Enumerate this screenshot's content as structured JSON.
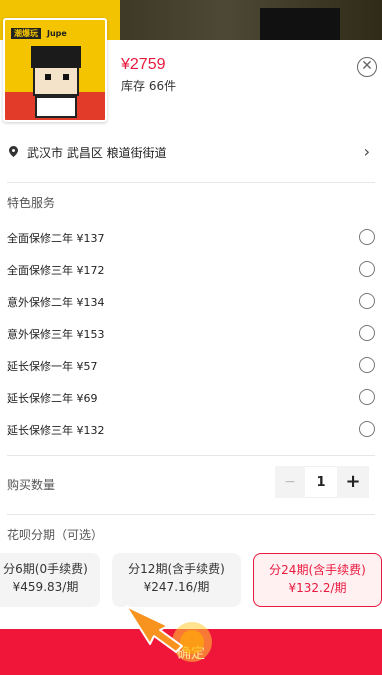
{
  "product": {
    "price": "¥2759",
    "stock": "库存 66件",
    "thumb_brands": [
      "潮爆玩",
      "Jupe"
    ]
  },
  "address": {
    "text": "武汉市 武昌区 粮道街街道",
    "chevron": "›"
  },
  "services": {
    "title": "特色服务",
    "items": [
      {
        "label": "全面保修二年 ¥137"
      },
      {
        "label": "全面保修三年 ¥172"
      },
      {
        "label": "意外保修二年 ¥134"
      },
      {
        "label": "意外保修三年 ¥153"
      },
      {
        "label": "延长保修一年 ¥57"
      },
      {
        "label": "延长保修二年 ¥69"
      },
      {
        "label": "延长保修三年 ¥132"
      }
    ]
  },
  "quantity": {
    "label": "购买数量",
    "minus": "−",
    "value": "1",
    "plus": "+"
  },
  "installments": {
    "title": "花呗分期（可选）",
    "options": [
      {
        "period": "分6期(0手续费)",
        "amount": "¥459.83/期",
        "selected": false
      },
      {
        "period": "分12期(含手续费)",
        "amount": "¥247.16/期",
        "selected": false
      },
      {
        "period": "分24期(含手续费)",
        "amount": "¥132.2/期",
        "selected": true
      }
    ]
  },
  "confirm_label": "确定",
  "icons": {
    "close": "close-icon",
    "location": "location-pin-icon",
    "chevron": "chevron-right-icon"
  },
  "colors": {
    "accent": "#f0163a",
    "price": "#e8193d",
    "banner": "#f2c300"
  }
}
